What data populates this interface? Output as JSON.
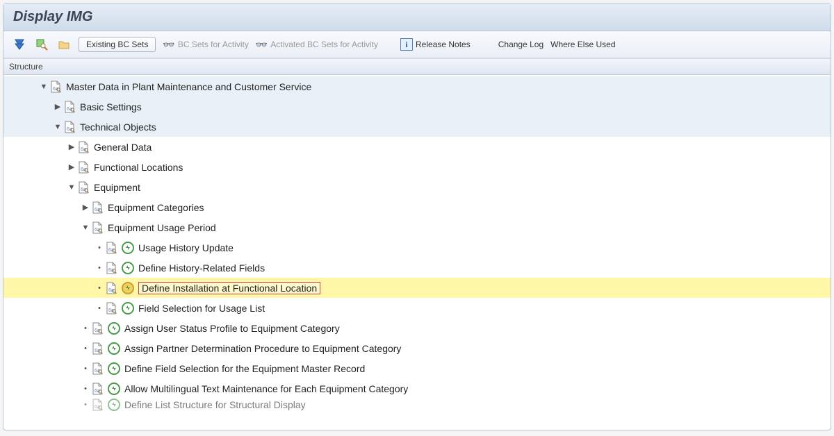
{
  "title": "Display IMG",
  "toolbar": {
    "existing_bc_sets": "Existing BC Sets",
    "bc_sets_for_activity": "BC Sets for Activity",
    "activated_bc_sets": "Activated BC Sets for Activity",
    "release_notes": "Release Notes",
    "change_log": "Change Log",
    "where_else_used": "Where Else Used"
  },
  "panel_header": "Structure",
  "tree": {
    "master_data": "Master Data in Plant Maintenance and Customer Service",
    "basic_settings": "Basic Settings",
    "technical_objects": "Technical Objects",
    "general_data": "General Data",
    "functional_locations": "Functional Locations",
    "equipment": "Equipment",
    "equipment_categories": "Equipment Categories",
    "equipment_usage_period": "Equipment Usage Period",
    "usage_history_update": "Usage History Update",
    "define_history_fields": "Define History-Related Fields",
    "define_installation": "Define Installation at Functional Location",
    "field_selection_usage": "Field Selection for Usage List",
    "assign_user_status": "Assign User Status Profile to Equipment Category",
    "assign_partner_det": "Assign Partner Determination Procedure to Equipment Category",
    "define_field_selection_master": "Define Field Selection for the Equipment Master Record",
    "allow_multilingual": "Allow Multilingual Text Maintenance for Each Equipment Category",
    "define_list_structure": "Define List Structure for Structural Display"
  }
}
